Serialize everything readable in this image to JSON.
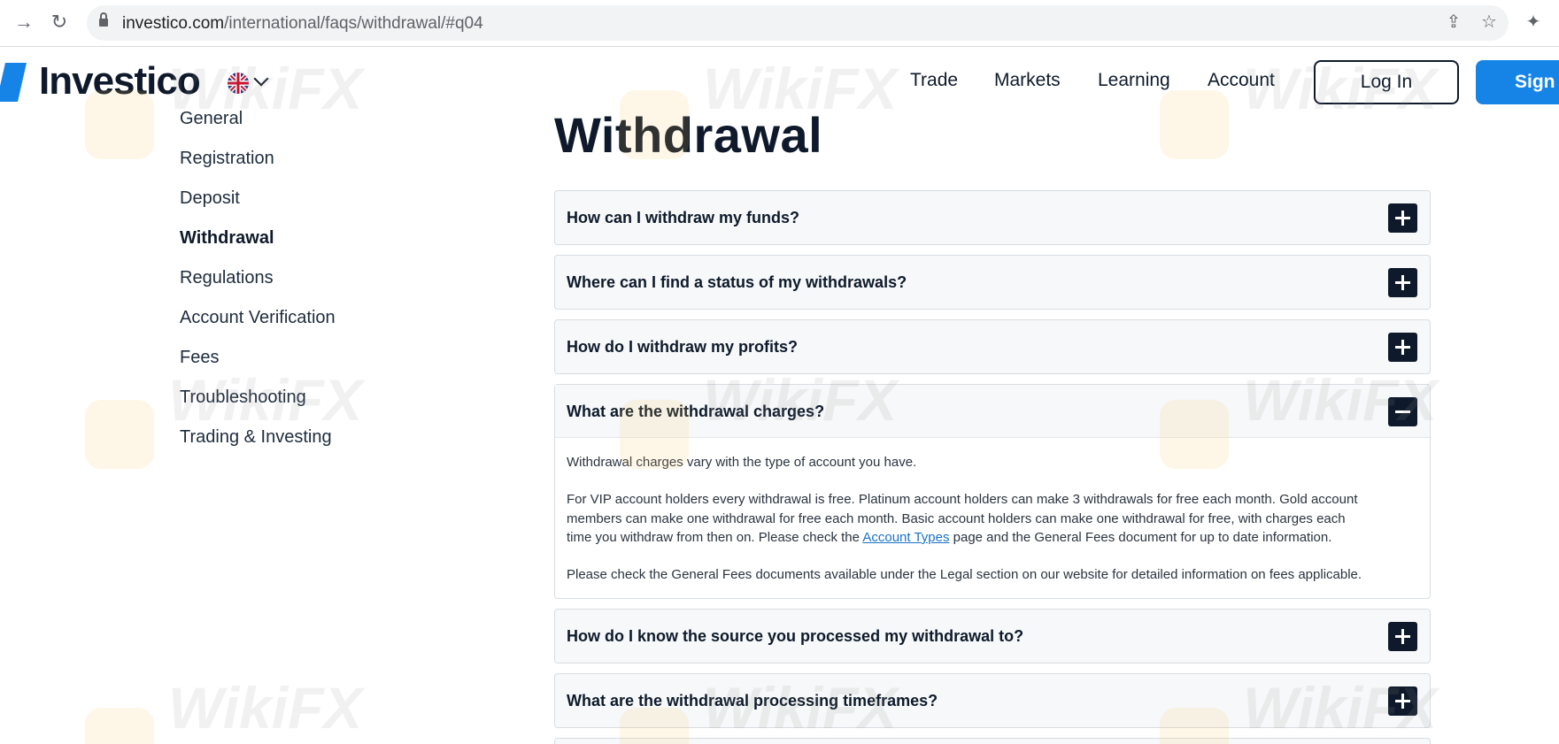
{
  "browser": {
    "url_host": "investico.com",
    "url_path": "/international/faqs/withdrawal/#q04"
  },
  "header": {
    "logo_text": "Investico",
    "menu": [
      "Trade",
      "Markets",
      "Learning",
      "Account"
    ],
    "login_label": "Log In",
    "signup_label": "Sign U"
  },
  "categories": [
    "General",
    "Registration",
    "Deposit",
    "Withdrawal",
    "Regulations",
    "Account Verification",
    "Fees",
    "Troubleshooting",
    "Trading & Investing"
  ],
  "active_category": "Withdrawal",
  "page": {
    "title": "Withdrawal"
  },
  "faqs": [
    {
      "question": "How can I withdraw my funds?"
    },
    {
      "question": "Where can I find a status of my withdrawals?"
    },
    {
      "question": "How do I withdraw my profits?"
    },
    {
      "question": "What are the withdrawal charges?",
      "answer_p1": "Withdrawal charges vary with the type of account you have.",
      "answer_p2_line1": "For VIP account holders every withdrawal is free. Platinum account holders can make 3 withdrawals for free each month. Gold account",
      "answer_p2_line2": "members can make one withdrawal for free each month. Basic account holders can make one withdrawal for free, with charges each",
      "answer_p2_line3_before": "time you withdraw from then on. Please check the ",
      "answer_p2_link": "Account Types",
      "answer_p2_line3_after": " page and the General Fees document for up to date information.",
      "answer_p3": "Please check the General Fees documents available under the Legal section on our website for detailed information on fees applicable."
    },
    {
      "question": "How do I know the source you processed my withdrawal to?"
    },
    {
      "question": "What are the withdrawal processing timeframes?"
    }
  ],
  "watermark_text": "WikiFX",
  "colors": {
    "navy": "#0e1a2b",
    "accent_blue": "#1684e6",
    "link_blue": "#1a73c8"
  }
}
